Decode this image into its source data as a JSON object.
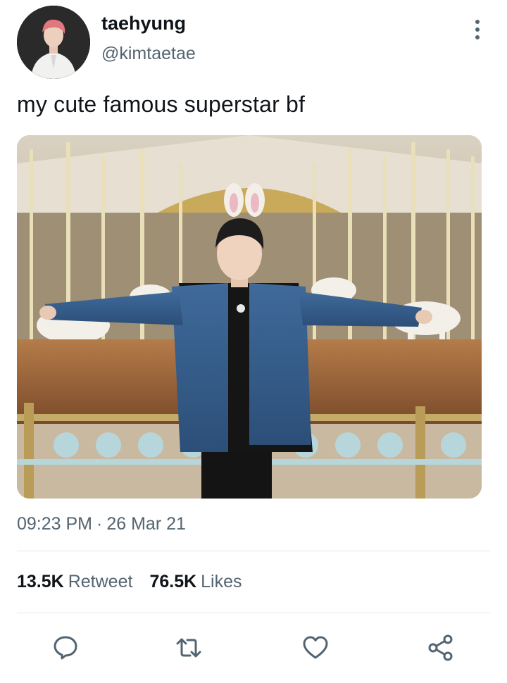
{
  "header": {
    "display_name": "taehyung",
    "handle": "@kimtaetae",
    "avatar_icon": "profile-photo",
    "more_icon": "more-vertical-icon"
  },
  "tweet": {
    "text": "my cute famous superstar bf",
    "media_description": "photo",
    "time": "09:23 PM",
    "separator": "·",
    "date": "26 Mar 21"
  },
  "stats": {
    "retweets_count": "13.5K",
    "retweets_label": "Retweet",
    "likes_count": "76.5K",
    "likes_label": "Likes"
  },
  "actions": [
    {
      "icon": "reply-icon"
    },
    {
      "icon": "retweet-icon"
    },
    {
      "icon": "like-icon"
    },
    {
      "icon": "share-icon"
    }
  ],
  "colors": {
    "primary_text": "#0f1419",
    "secondary_text": "#536471",
    "divider": "#e1e6ea"
  }
}
